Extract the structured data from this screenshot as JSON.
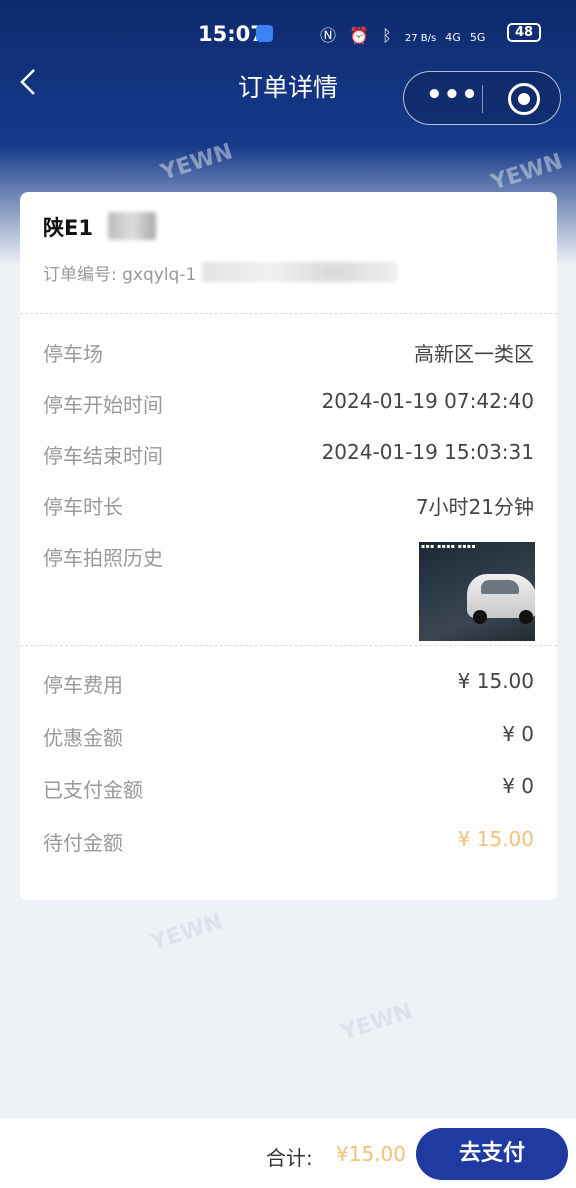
{
  "status_bar": {
    "time": "15:07",
    "net_speed": "27 B/s",
    "signal1": "4G",
    "signal2": "5G",
    "battery": "48"
  },
  "nav": {
    "title": "订单详情",
    "back_icon": "chevron-left-icon",
    "more_icon": "more-dots-icon",
    "close_icon": "target-close-icon"
  },
  "order": {
    "plate": "陕E1",
    "order_no": "订单编号: gxqylq-1"
  },
  "parking_info": [
    {
      "label": "停车场",
      "value": "高新区一类区"
    },
    {
      "label": "停车开始时间",
      "value": "2024-01-19 07:42:40"
    },
    {
      "label": "停车结束时间",
      "value": "2024-01-19 15:03:31"
    },
    {
      "label": "停车时长",
      "value": "7小时21分钟"
    },
    {
      "label": "停车拍照历史",
      "value": ""
    }
  ],
  "fees": [
    {
      "label": "停车费用",
      "value": "¥ 15.00"
    },
    {
      "label": "优惠金额",
      "value": "¥ 0"
    },
    {
      "label": "已支付金额",
      "value": "¥ 0"
    },
    {
      "label": "待付金额",
      "value": "¥ 15.00"
    }
  ],
  "footer": {
    "total_label": "合计:",
    "total_value": "¥15.00",
    "pay_label": "去支付"
  },
  "colors": {
    "header": "#0e2a6e",
    "accent_orange": "#f1c27b",
    "pay_button": "#1f3aa0"
  }
}
